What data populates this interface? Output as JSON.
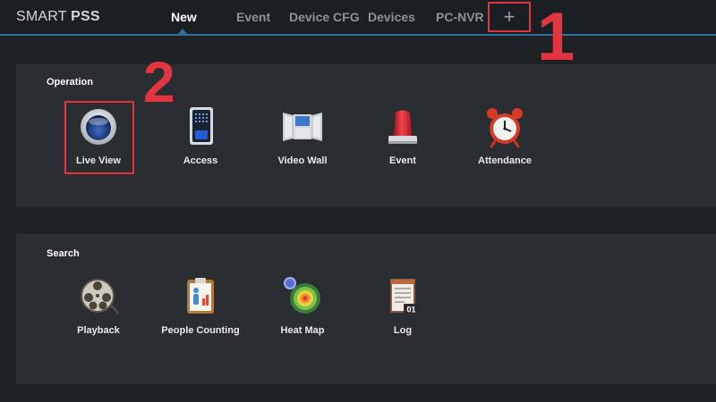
{
  "app": {
    "brand_light": "SMART ",
    "brand_bold": "PSS"
  },
  "tabs": [
    {
      "label": "New",
      "active": true
    },
    {
      "label": "Event",
      "active": false
    },
    {
      "label": "Device CFG",
      "active": false
    },
    {
      "label": "Devices",
      "active": false
    },
    {
      "label": "PC-NVR",
      "active": false
    }
  ],
  "add_tab": {
    "label": "+"
  },
  "annotations": {
    "step1": "1",
    "step2": "2"
  },
  "sections": {
    "operation": {
      "title": "Operation",
      "items": [
        {
          "label": "Live View",
          "icon": "live-view-icon"
        },
        {
          "label": "Access",
          "icon": "access-icon"
        },
        {
          "label": "Video Wall",
          "icon": "video-wall-icon"
        },
        {
          "label": "Event",
          "icon": "alarm-light-icon"
        },
        {
          "label": "Attendance",
          "icon": "alarm-clock-icon"
        }
      ]
    },
    "search": {
      "title": "Search",
      "items": [
        {
          "label": "Playback",
          "icon": "film-reel-icon"
        },
        {
          "label": "People Counting",
          "icon": "people-counting-icon"
        },
        {
          "label": "Heat Map",
          "icon": "heat-map-icon"
        },
        {
          "label": "Log",
          "icon": "log-icon"
        }
      ]
    }
  },
  "colors": {
    "background": "#1e2126",
    "panel": "#2a2d32",
    "accent_blue": "#2f6f9b",
    "annotation_red": "#e2353f"
  }
}
